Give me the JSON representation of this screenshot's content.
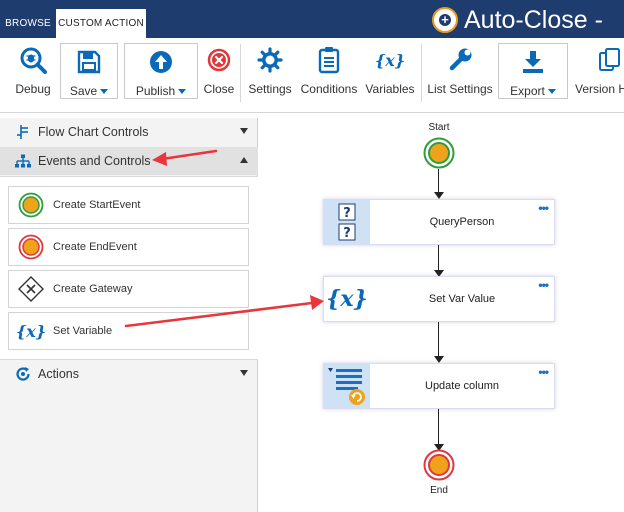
{
  "tabs": {
    "browse": "BROWSE",
    "custom_action": "CUSTOM ACTION"
  },
  "app": {
    "title": "Auto-Close -"
  },
  "ribbon": {
    "debug": "Debug",
    "save": "Save",
    "publish": "Publish",
    "close": "Close",
    "settings": "Settings",
    "conditions": "Conditions",
    "variables": "Variables",
    "list_settings": "List Settings",
    "export": "Export",
    "version_history": "Version H"
  },
  "panel": {
    "flow_chart_controls": "Flow Chart Controls",
    "events_and_controls": "Events and Controls",
    "tools": {
      "create_start_event": "Create StartEvent",
      "create_end_event": "Create EndEvent",
      "create_gateway": "Create Gateway",
      "set_variable": "Set Variable"
    },
    "actions": "Actions"
  },
  "canvas": {
    "start_label": "Start",
    "end_label": "End",
    "nodes": {
      "query_person": "QueryPerson",
      "set_var_value": "Set Var Value",
      "update_column": "Update column"
    },
    "more_dots": "•••"
  },
  "colors": {
    "topbar": "#1f3c6e",
    "accent_blue": "#0a6ab8",
    "start_green": "#2e9e3a",
    "end_red": "#e0383a",
    "event_fill": "#f0a21a",
    "annotation_arrow": "#e8363b"
  },
  "icons": {
    "debug": "bug-search-icon",
    "save": "floppy-disk-icon",
    "publish": "upload-arrow-icon",
    "close": "close-circle-icon",
    "settings": "gear-icon",
    "conditions": "clipboard-list-icon",
    "variables": "variable-braces-icon",
    "list_settings": "wrench-icon",
    "export": "download-tray-icon",
    "version_history": "copy-pages-icon"
  }
}
